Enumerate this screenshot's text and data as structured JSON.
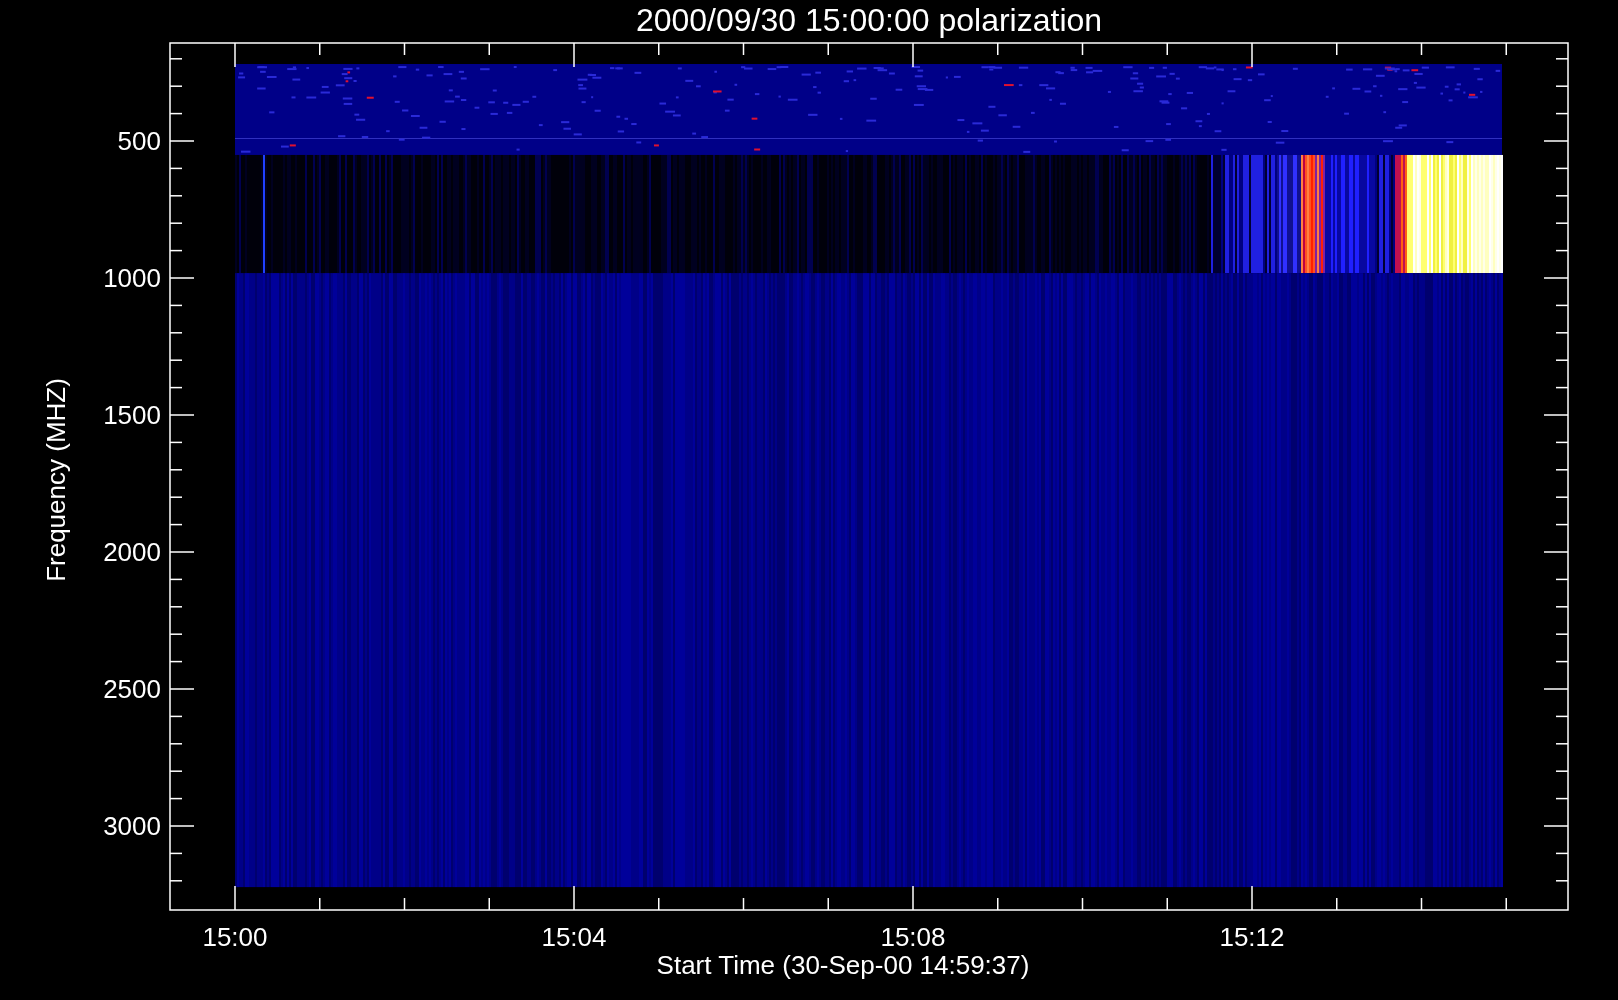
{
  "title": "2000/09/30 15:00:00 polarization",
  "y_axis": {
    "label": "Frequency (MHZ)",
    "ticks": [
      "500",
      "1000",
      "1500",
      "2000",
      "2500",
      "3000"
    ]
  },
  "x_axis": {
    "label": "Start Time (30-Sep-00 14:59:37)",
    "ticks": [
      "15:00",
      "15:04",
      "15:08",
      "15:12"
    ]
  }
}
